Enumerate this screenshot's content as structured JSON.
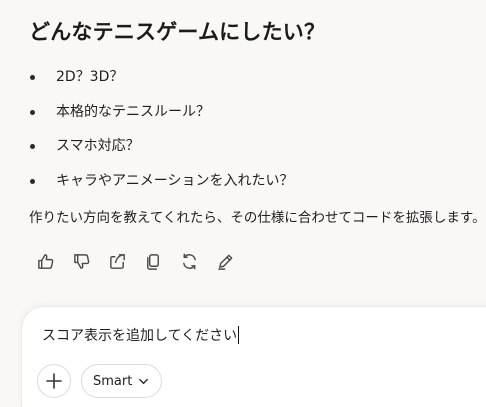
{
  "response": {
    "heading": "どんなテニスゲームにしたい？",
    "questions": [
      "2D？3D？",
      "本格的なテニスルール？",
      "スマホ対応？",
      "キャラやアニメーションを入れたい？"
    ],
    "summary": "作りたい方向を教えてくれたら、その仕様に合わせてコードを拡張します。"
  },
  "actions": [
    {
      "icon": "thumbs-up-icon"
    },
    {
      "icon": "thumbs-down-icon"
    },
    {
      "icon": "share-icon"
    },
    {
      "icon": "copy-icon"
    },
    {
      "icon": "regenerate-icon"
    },
    {
      "icon": "edit-icon"
    }
  ],
  "composer": {
    "input_value": "スコア表示を追加してください",
    "mode_label": "Smart"
  }
}
